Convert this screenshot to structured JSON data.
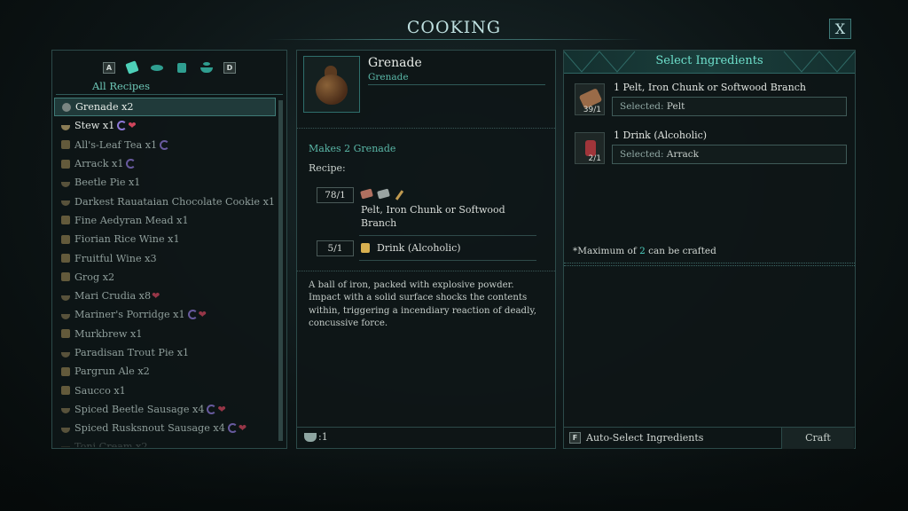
{
  "title": "COOKING",
  "close_label": "X",
  "filters": {
    "key_left": "A",
    "key_right": "D",
    "active_label": "All Recipes",
    "icons": [
      "scroll-icon",
      "fish-icon",
      "mug-icon",
      "bowl-icon"
    ]
  },
  "recipes": [
    {
      "name": "Grenade x2",
      "icon": "grenade",
      "state": "selected"
    },
    {
      "name": "Stew x1",
      "icon": "bowl",
      "state": "available",
      "spiral": true,
      "heart": true
    },
    {
      "name": "All's-Leaf Tea x1",
      "icon": "mug",
      "state": "locked",
      "spiral": true
    },
    {
      "name": "Arrack x1",
      "icon": "mug",
      "state": "locked",
      "spiral": true
    },
    {
      "name": "Beetle Pie x1",
      "icon": "bowl",
      "state": "locked"
    },
    {
      "name": "Darkest Rauataian Chocolate Cookie x1",
      "icon": "bowl",
      "state": "locked"
    },
    {
      "name": "Fine Aedyran Mead x1",
      "icon": "mug",
      "state": "locked"
    },
    {
      "name": "Fiorian Rice Wine x1",
      "icon": "mug",
      "state": "locked"
    },
    {
      "name": "Fruitful Wine x3",
      "icon": "mug",
      "state": "locked"
    },
    {
      "name": "Grog x2",
      "icon": "mug",
      "state": "locked"
    },
    {
      "name": "Mari Crudia x8",
      "icon": "bowl",
      "state": "locked",
      "heart": true
    },
    {
      "name": "Mariner's Porridge x1",
      "icon": "bowl",
      "state": "locked",
      "spiral": true,
      "heart": true
    },
    {
      "name": "Murkbrew x1",
      "icon": "mug",
      "state": "locked"
    },
    {
      "name": "Paradisan Trout Pie x1",
      "icon": "bowl",
      "state": "locked"
    },
    {
      "name": "Pargrun Ale x2",
      "icon": "mug",
      "state": "locked"
    },
    {
      "name": "Saucco x1",
      "icon": "mug",
      "state": "locked"
    },
    {
      "name": "Spiced Beetle Sausage x4",
      "icon": "bowl",
      "state": "locked",
      "spiral": true,
      "heart": true
    },
    {
      "name": "Spiced Rusksnout Sausage x4",
      "icon": "bowl",
      "state": "locked",
      "spiral": true,
      "heart": true
    },
    {
      "name": "Toni Cream x2",
      "icon": "bowl",
      "state": "faded"
    }
  ],
  "detail": {
    "name": "Grenade",
    "subtitle": "Grenade",
    "makes": "Makes 2 Grenade",
    "recipe_label": "Recipe:",
    "ingredients": [
      {
        "qty": "78/1",
        "name": "Pelt, Iron Chunk or Softwood Branch",
        "icons": [
          "pelt-icon",
          "iron-chunk-icon",
          "branch-icon"
        ]
      },
      {
        "qty": "5/1",
        "name": "Drink (Alcoholic)",
        "icons": [
          "mug-icon"
        ]
      }
    ],
    "description": "A ball of iron, packed with explosive powder. Impact with a solid surface shocks the contents within, triggering a incendiary reaction of deadly, concussive force.",
    "pot_count": ":1"
  },
  "select": {
    "title": "Select Ingredients",
    "slots": [
      {
        "title": "1 Pelt, Iron Chunk or Softwood Branch",
        "count": "39/1",
        "selected_key": "Selected:",
        "selected_value": "Pelt",
        "icon": "pelt-icon"
      },
      {
        "title": "1 Drink (Alcoholic)",
        "count": "2/1",
        "selected_key": "Selected:",
        "selected_value": "Arrack",
        "icon": "bottle-icon"
      }
    ],
    "max_prefix": "*Maximum of ",
    "max_value": "2",
    "max_suffix": " can be crafted",
    "auto_key": "F",
    "auto_label": "Auto-Select Ingredients",
    "craft_label": "Craft"
  },
  "colors": {
    "accent": "#4ed0c0",
    "heart": "#d0455c",
    "spiral": "#8e78d8"
  }
}
